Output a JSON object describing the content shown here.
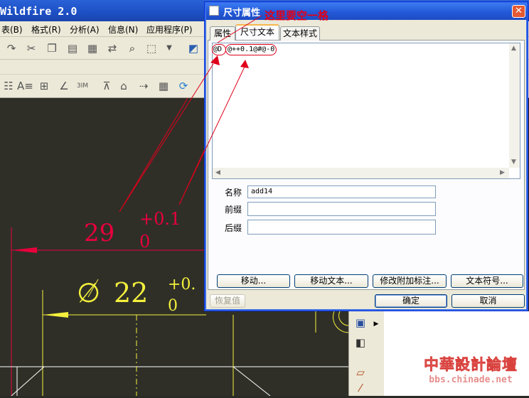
{
  "app": {
    "title": "Wildfire 2.0"
  },
  "menu": [
    {
      "label": "表(B)"
    },
    {
      "label": "格式(R)"
    },
    {
      "label": "分析(A)"
    },
    {
      "label": "信息(N)"
    },
    {
      "label": "应用程序(P)"
    }
  ],
  "dialog": {
    "title": "尺寸属性",
    "close_glyph": "✕",
    "tabs": [
      {
        "label": "属性",
        "active": false
      },
      {
        "label": "尺寸文本",
        "active": true
      },
      {
        "label": "文本样式",
        "active": false
      }
    ],
    "text_prefix": "@D",
    "text_value": "@++0.1@#@-0",
    "fields": {
      "name": {
        "label": "名称",
        "value": "add14"
      },
      "prefix": {
        "label": "前缀",
        "value": ""
      },
      "suffix": {
        "label": "后缀",
        "value": ""
      }
    },
    "buttons": {
      "move": "移动...",
      "move_text": "移动文本...",
      "modify_attached": "修改附加标注...",
      "text_symbol": "文本符号...",
      "restore": "恢复值",
      "ok": "确定",
      "cancel": "取消"
    }
  },
  "annotation": {
    "text": "这里要空一格",
    "color": "#e0001a"
  },
  "drawing": {
    "dim1_value": "29",
    "dim1_upper": "+0.1",
    "dim1_lower": "0",
    "dim2_symbol": "∅",
    "dim2_value": "22",
    "dim2_upper": "+0.",
    "dim2_lower": "0",
    "dim1_color": "#e8003c",
    "dim2_color": "#f4f03c"
  },
  "watermark": {
    "name": "中華設計論壇",
    "url": "bbs.chinade.net"
  },
  "colors": {
    "xp_blue": "#2359d8",
    "face": "#ece9d8",
    "canvas": "#2f2f28"
  }
}
